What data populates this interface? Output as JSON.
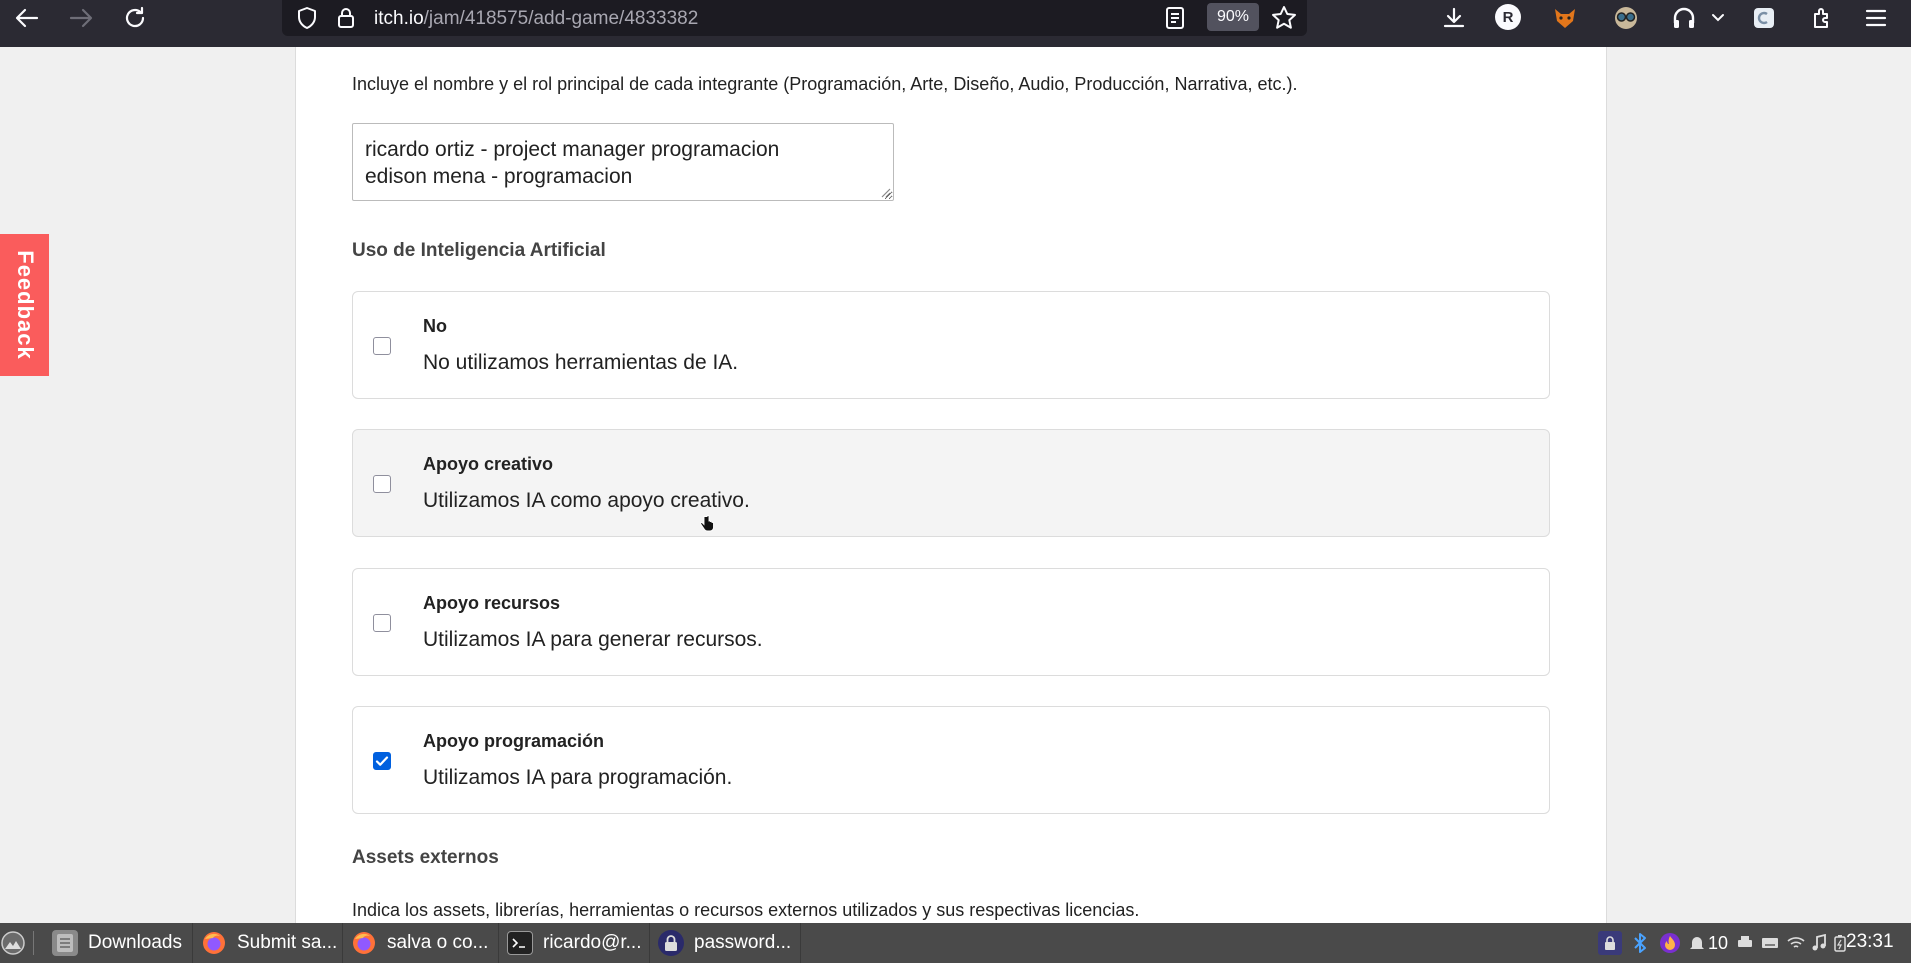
{
  "browser": {
    "url_host": "itch.io",
    "url_path": "/jam/418575/add-game/4833382",
    "zoom": "90%",
    "profile_initial": "R"
  },
  "form": {
    "team_hint": "Incluye el nombre y el rol principal de cada integrante (Programación, Arte, Diseño, Audio, Producción, Narrativa, etc.).",
    "team_lines": [
      "ricardo ortiz - project manager programacion",
      "edison mena - programacion"
    ],
    "ai_section_label": "Uso de Inteligencia Artificial",
    "ai_options": [
      {
        "title": "No",
        "desc": "No utilizamos herramientas de IA.",
        "checked": false
      },
      {
        "title": "Apoyo creativo",
        "desc": "Utilizamos IA como apoyo creativo.",
        "checked": false
      },
      {
        "title": "Apoyo recursos",
        "desc": "Utilizamos IA para generar recursos.",
        "checked": false
      },
      {
        "title": "Apoyo programación",
        "desc": "Utilizamos IA para programación.",
        "checked": true
      }
    ],
    "assets_label": "Assets externos",
    "assets_hint": "Indica los assets, librerías, herramientas o recursos externos utilizados y sus respectivas licencias."
  },
  "feedback_label": "Feedback",
  "taskbar": {
    "tasks": [
      "Downloads",
      "Submit sa...",
      "salva o co...",
      "ricardo@r...",
      "password..."
    ],
    "notification_count": "10",
    "clock": "23:31"
  },
  "colors": {
    "toolbar_bg": "#2b2a33",
    "feedback_bg": "#fa5c5c",
    "checkbox_checked": "#0060df",
    "taskbar_bg": "#4a4a4a"
  }
}
